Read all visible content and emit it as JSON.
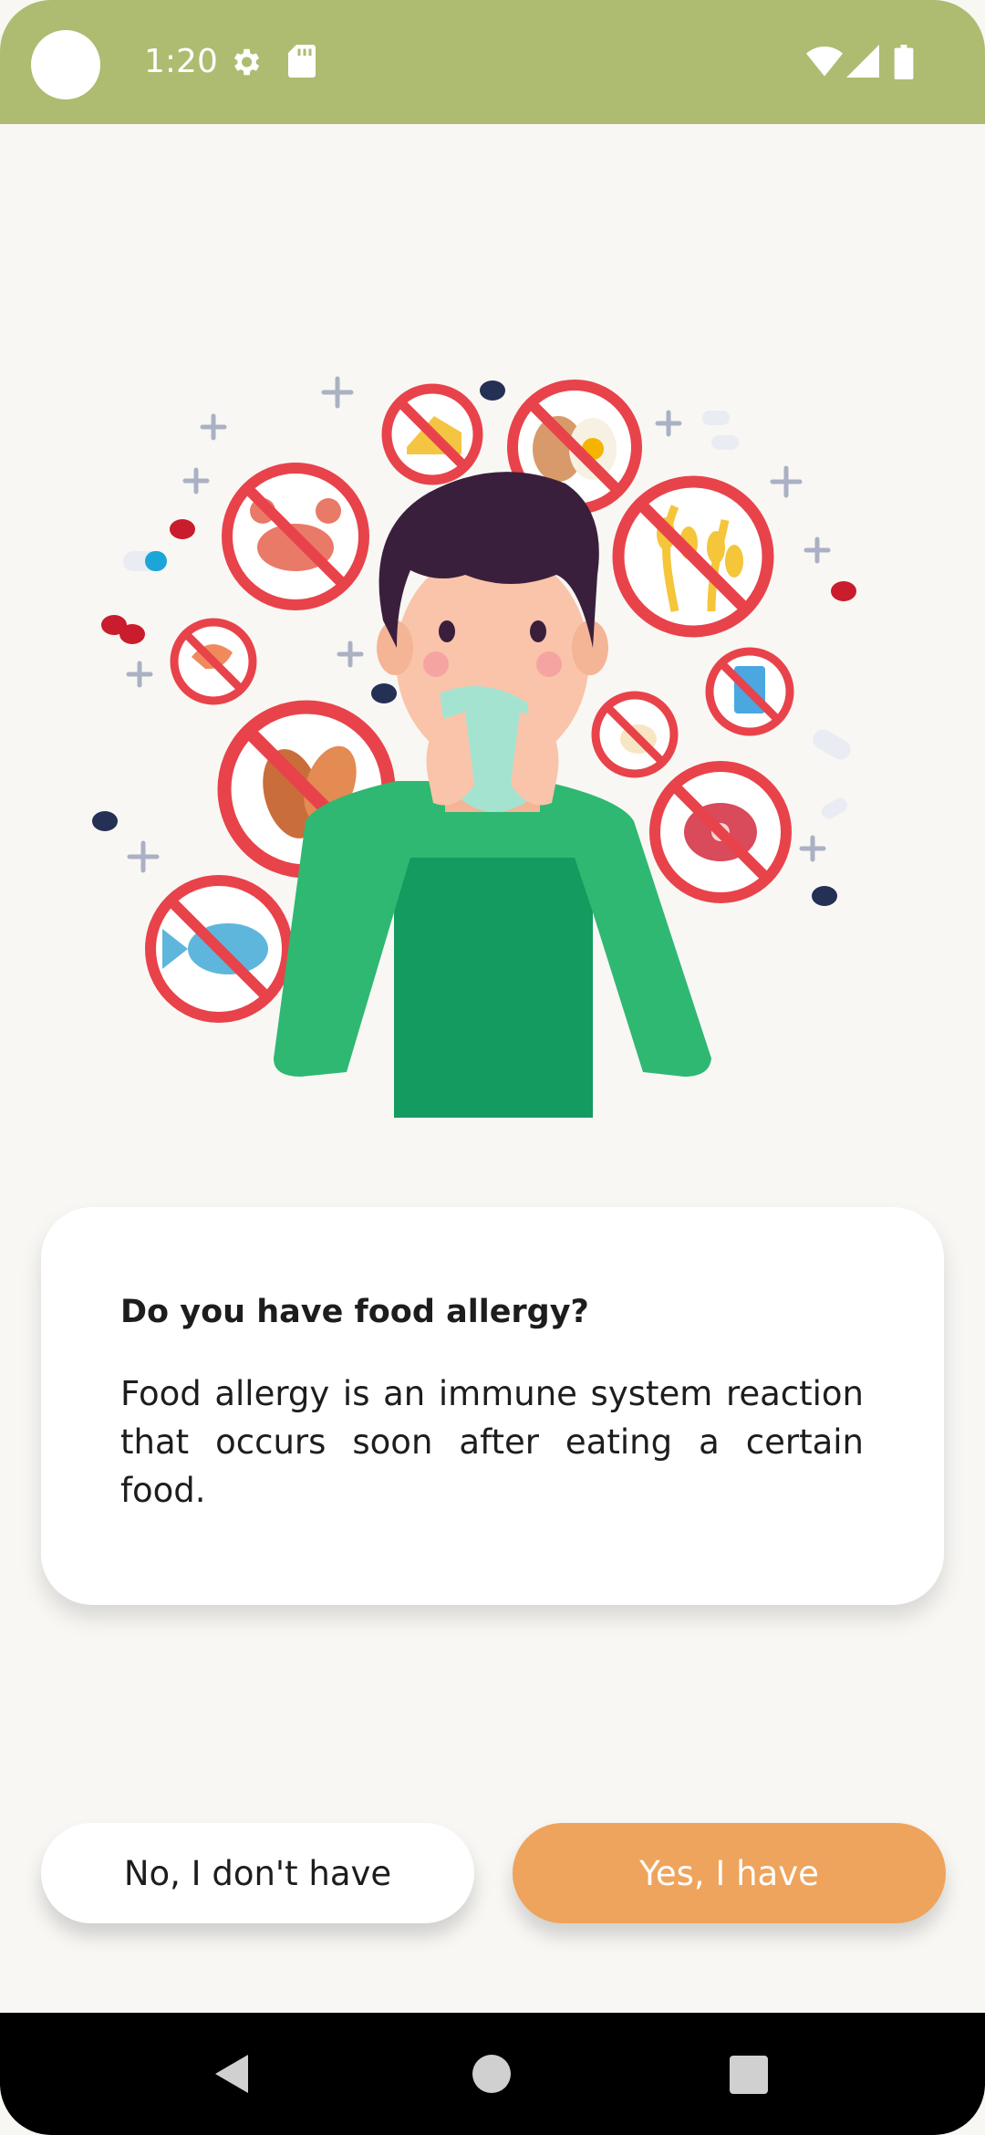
{
  "status_bar": {
    "time": "1:20",
    "icons": [
      "camera-cutout",
      "settings-gear-icon",
      "sd-card-icon",
      "wifi-icon",
      "cellular-signal-icon",
      "battery-icon"
    ]
  },
  "illustration": {
    "description_icon": "food-allergy-illustration"
  },
  "card": {
    "title": "Do you have food allergy?",
    "body": "Food allergy is an immune system reaction that occurs soon after eating a certain food."
  },
  "buttons": {
    "no_label": "No, I don't have",
    "yes_label": "Yes, I have"
  },
  "colors": {
    "status_bar": "#adbc70",
    "background": "#f8f7f4",
    "accent": "#eea45c",
    "ban_red": "#e8434a",
    "shirt_green": "#2fb872"
  },
  "nav_bar": {
    "icons": [
      "back-icon",
      "home-icon",
      "recents-icon"
    ]
  }
}
